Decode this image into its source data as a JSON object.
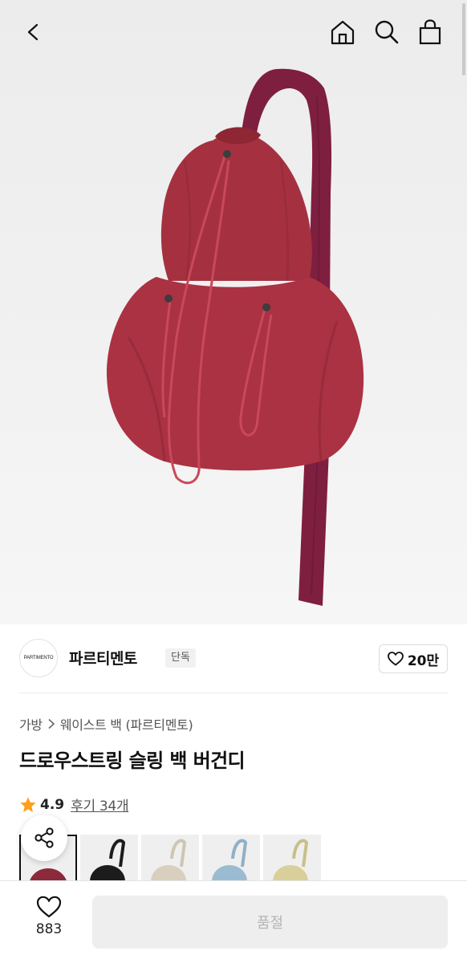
{
  "header": {
    "back_icon": "chevron-left-icon",
    "home_icon": "home-icon",
    "search_icon": "search-icon",
    "cart_icon": "shopping-bag-icon"
  },
  "brand": {
    "logo_text": "PARTIMENTO",
    "name": "파르티멘토",
    "badge": "단독",
    "likes": "20만"
  },
  "breadcrumb": {
    "category": "가방",
    "subcategory": "웨이스트 백 (파르티멘토)"
  },
  "product": {
    "title": "드로우스트링 슬링 백 버건디",
    "rating": "4.9",
    "reviews": "후기 34개"
  },
  "color_options": [
    {
      "name": "burgundy",
      "color": "#8b2a3a",
      "selected": true
    },
    {
      "name": "black",
      "color": "#1c1c1c",
      "selected": false
    },
    {
      "name": "beige",
      "color": "#d8cfbf",
      "selected": false
    },
    {
      "name": "light-blue",
      "color": "#9bbbd2",
      "selected": false
    },
    {
      "name": "butter",
      "color": "#d9cf9a",
      "selected": false
    }
  ],
  "bottom": {
    "wish_count": "883",
    "button_label": "품절"
  },
  "colors": {
    "bag": "#a8323f",
    "strap": "#7e1f40"
  }
}
